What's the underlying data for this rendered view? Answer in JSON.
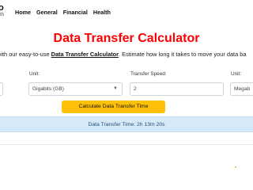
{
  "nav": {
    "logo_main": "o",
    "logo_sub": "th",
    "links": [
      "Home",
      "General",
      "Financial",
      "Health"
    ]
  },
  "page": {
    "title": "Data Transfer Calculator",
    "intro_prefix": "with our easy-to-use ",
    "intro_link": "Data Transfer Calculator",
    "intro_suffix": ". Estimate how long it takes to move your data ba"
  },
  "form": {
    "unit_label": "Unit:",
    "unit_value": "Gigabits (GB)",
    "speed_label": "Transfer Speed:",
    "speed_value": "2",
    "speed_unit_label": "Unit:",
    "speed_unit_value": "Megab"
  },
  "button": {
    "label": "Calculate Data Transfer Time"
  },
  "result": {
    "text": "Data Transfer Time: 2h 13m 20s"
  },
  "colors": {
    "title": "#ff0000",
    "button": "#ffc107",
    "result_bg": "#d6e9f8"
  }
}
